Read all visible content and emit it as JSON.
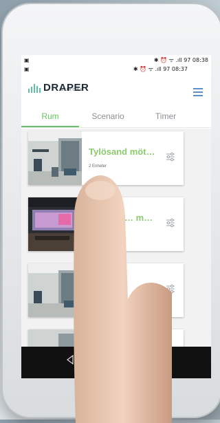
{
  "status_top": {
    "left_icon": "screenshot-icon",
    "right_text": "✱ ⏰ ᯤ .ıll 97 08:38"
  },
  "status_second": {
    "left_icon": "screenshot-icon",
    "right_text": "✱ ⏰ ᯤ .ıll 97 08:37"
  },
  "header": {
    "brand": "DRAPER",
    "brand_sub": "EUROPE",
    "menu_icon": "hamburger-icon"
  },
  "tabs": [
    {
      "label": "Rum",
      "active": true
    },
    {
      "label": "Scenario",
      "active": false
    },
    {
      "label": "Timer",
      "active": false
    }
  ],
  "cards": [
    {
      "title": "Tylösand möt…",
      "subtitle": "2 Enheter",
      "icon": "sliders-icon"
    },
    {
      "title": "… m…",
      "subtitle": "",
      "icon": "sliders-icon"
    },
    {
      "title": "",
      "subtitle": "",
      "icon": "sliders-icon"
    }
  ],
  "fab": {
    "label": "+"
  },
  "colors": {
    "accent": "#6dbf6b",
    "title_green": "#8cca6e",
    "fab": "#6dc5a8",
    "brand": "#1b2735",
    "menu": "#5a8fc7"
  }
}
